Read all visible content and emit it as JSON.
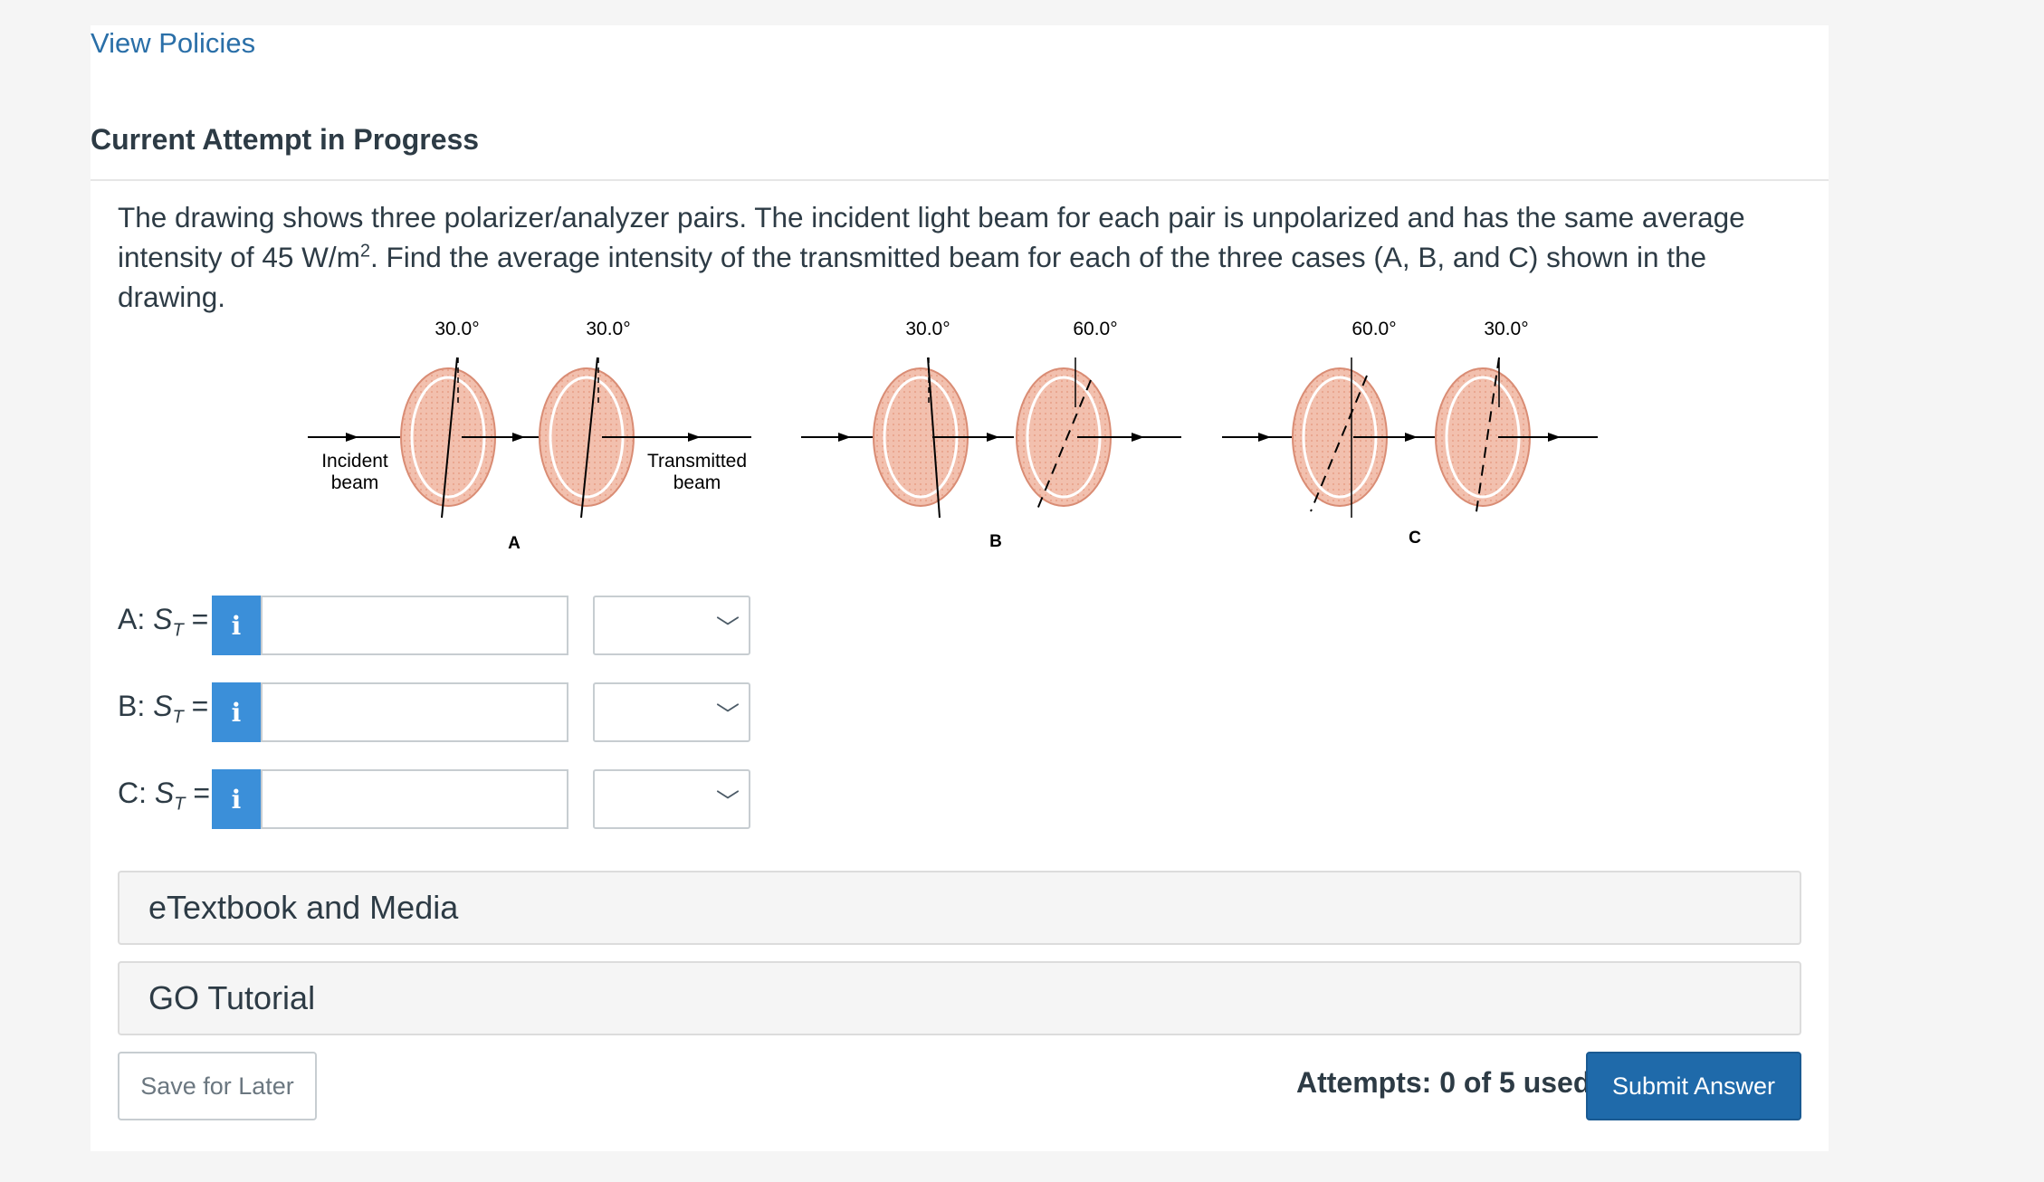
{
  "header": {
    "view_policies": "View Policies",
    "attempt_title": "Current Attempt in Progress"
  },
  "question": {
    "text_before_sup": "The drawing shows three polarizer/analyzer pairs. The incident light beam for each pair is unpolarized and has the same average intensity of 45 W/m",
    "sup": "2",
    "text_after_sup": ". Find the average intensity of the transmitted beam for each of the three cases (A, B, and C) shown in the drawing."
  },
  "figure": {
    "incident_label_1": "Incident",
    "incident_label_2": "beam",
    "transmitted_label_1": "Transmitted",
    "transmitted_label_2": "beam",
    "case_a": "A",
    "case_b": "B",
    "case_c": "C",
    "angles": {
      "a1": "30.0°",
      "a2": "30.0°",
      "b1": "30.0°",
      "b2": "60.0°",
      "c1": "60.0°",
      "c2": "30.0°"
    },
    "colors": {
      "disk_fill": "#f0b8a4",
      "disk_stroke": "#d98c74",
      "line": "#000000"
    }
  },
  "answers": [
    {
      "prefix": "A: ",
      "var": "S",
      "sub": "T",
      "suffix": " =",
      "info_icon": "i",
      "value": "",
      "unit": ""
    },
    {
      "prefix": "B: ",
      "var": "S",
      "sub": "T",
      "suffix": " =",
      "info_icon": "i",
      "value": "",
      "unit": ""
    },
    {
      "prefix": "C: ",
      "var": "S",
      "sub": "T",
      "suffix": " =",
      "info_icon": "i",
      "value": "",
      "unit": ""
    }
  ],
  "sections": {
    "etextbook": "eTextbook and Media",
    "go_tutorial": "GO Tutorial"
  },
  "footer": {
    "save_label": "Save for Later",
    "attempts": "Attempts: 0 of 5 used",
    "submit_label": "Submit Answer"
  },
  "colors": {
    "link": "#2a6fa8",
    "info_button": "#3b8fd9",
    "submit_button": "#1f6aaa"
  }
}
